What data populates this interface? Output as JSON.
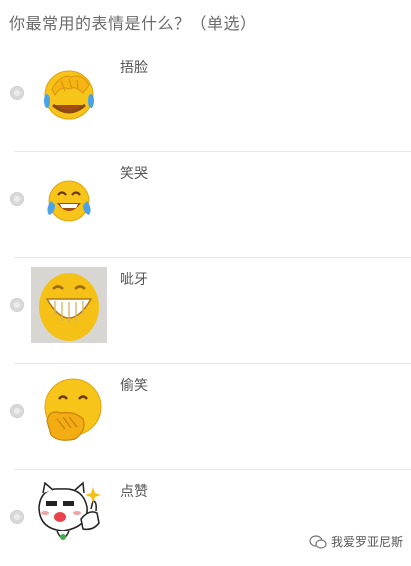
{
  "question": {
    "title": "你最常用的表情是什么？（单选）"
  },
  "options": [
    {
      "label": "捂脸",
      "icon": "facepalm-emoji",
      "selected": false
    },
    {
      "label": "笑哭",
      "icon": "tears-of-joy-emoji",
      "selected": false
    },
    {
      "label": "呲牙",
      "icon": "grin-emoji",
      "selected": false
    },
    {
      "label": "偷笑",
      "icon": "snicker-emoji",
      "selected": false
    },
    {
      "label": "点赞",
      "icon": "thumbs-up-cat-emoji",
      "selected": false
    }
  ],
  "watermark": {
    "text": "我爱罗亚尼斯"
  },
  "colors": {
    "emoji_yellow": "#f7c419",
    "tear_blue": "#4aa3e8",
    "radio_gray": "#d9d9d9",
    "text_gray": "#555555"
  }
}
